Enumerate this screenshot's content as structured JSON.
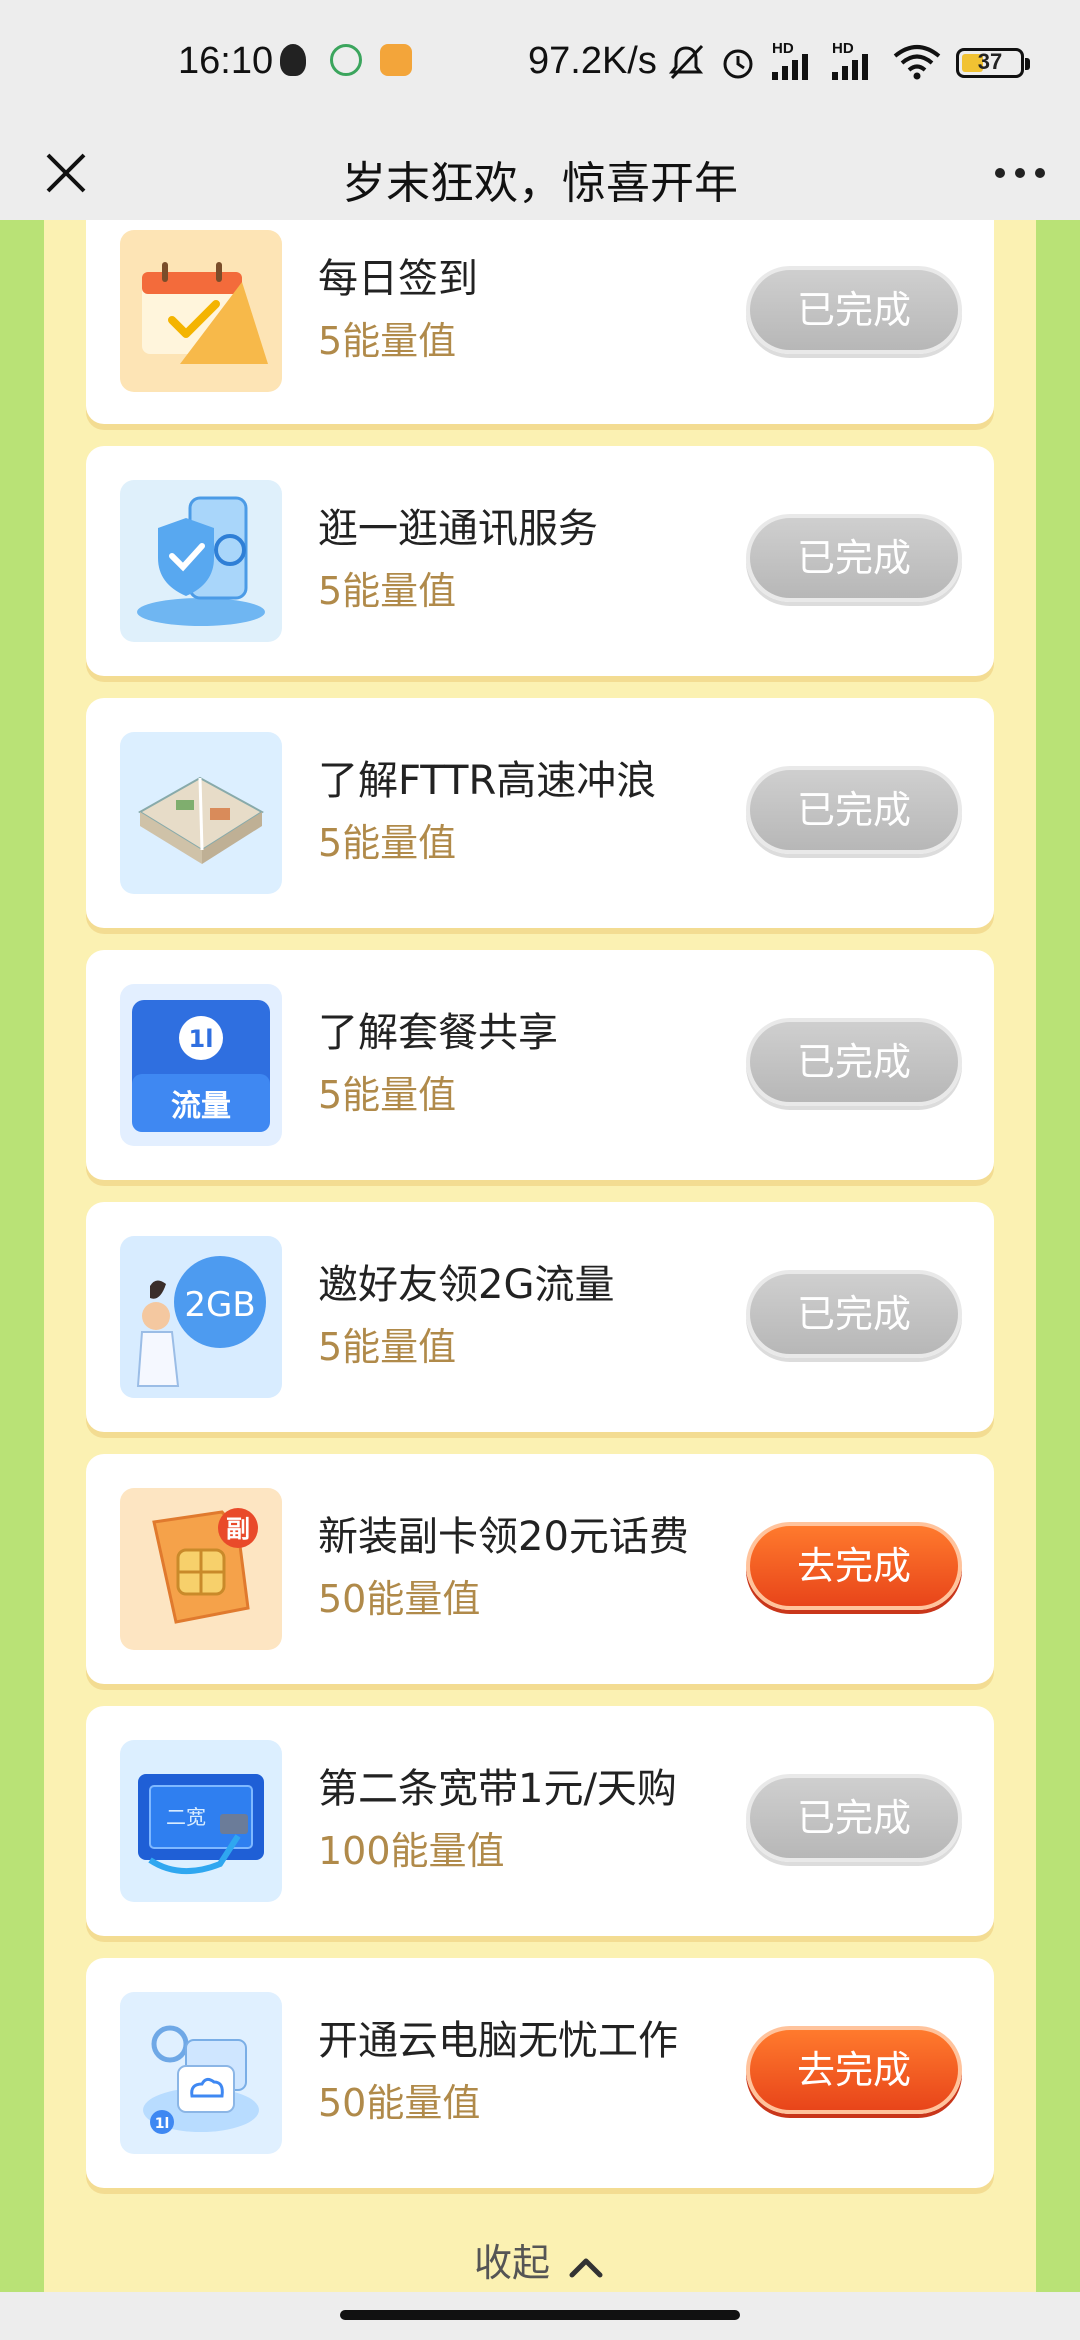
{
  "status_bar": {
    "time": "16:10",
    "network_speed": "97.2K/s",
    "signal1_label": "HD",
    "signal2_label": "HD",
    "battery": "37",
    "battery_level": 0.37,
    "icons": [
      "qq-icon",
      "leaf-app-icon",
      "note-app-icon",
      "mute-icon",
      "alarm-icon",
      "signal-icon",
      "signal-icon",
      "wifi-icon",
      "battery-icon"
    ]
  },
  "header": {
    "title": "岁末狂欢，惊喜开年",
    "close_icon": "close-icon",
    "more_icon": "more-icon"
  },
  "tasks": [
    {
      "title": "每日签到",
      "points": "5能量值",
      "button": "已完成",
      "state": "done",
      "icon": "calendar-check-icon"
    },
    {
      "title": "逛一逛通讯服务",
      "points": "5能量值",
      "button": "已完成",
      "state": "done",
      "icon": "shield-phone-icon"
    },
    {
      "title": "了解FTTR高速冲浪",
      "points": "5能量值",
      "button": "已完成",
      "state": "done",
      "icon": "house-plan-icon"
    },
    {
      "title": "了解套餐共享",
      "points": "5能量值",
      "button": "已完成",
      "state": "done",
      "icon": "data-package-icon",
      "icon_label": "流量"
    },
    {
      "title": "邀好友领2G流量",
      "points": "5能量值",
      "button": "已完成",
      "state": "done",
      "icon": "invite-2gb-icon",
      "icon_label": "2GB"
    },
    {
      "title": "新装副卡领20元话费",
      "points": "50能量值",
      "button": "去完成",
      "state": "todo",
      "icon": "sim-card-icon",
      "icon_label": "副"
    },
    {
      "title": "第二条宽带1元/天购",
      "points": "100能量值",
      "button": "已完成",
      "state": "done",
      "icon": "broadband-router-icon",
      "icon_label": "二宽"
    },
    {
      "title": "开通云电脑无忧工作",
      "points": "50能量值",
      "button": "去完成",
      "state": "todo",
      "icon": "cloud-computer-icon"
    }
  ],
  "footer": {
    "collapse_label": "收起",
    "collapse_icon": "chevron-up-icon"
  },
  "colors": {
    "page_bg": "#b9e276",
    "panel_bg": "#fbf1b2",
    "points_text": "#b08a4a",
    "done_button": "#c4c4c4",
    "todo_button": "#f0561f"
  }
}
